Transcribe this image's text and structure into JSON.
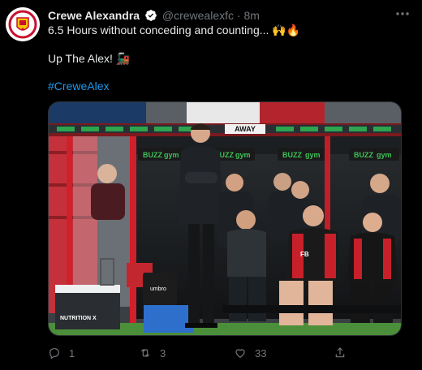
{
  "author": {
    "name": "Crewe Alexandra",
    "handle": "@crewealexfc",
    "time": "8m"
  },
  "tweet": {
    "line1": "6.5 Hours without conceding and counting... 🙌🔥",
    "line2": "Up The Alex! 🚂",
    "hashtag": "#CreweAlex"
  },
  "image_text": {
    "away_sign": "AWAY",
    "sponsor1": "BUZZ",
    "sponsor1b": "gym",
    "sponsor2": "BUZZ",
    "sponsor2b": "gym",
    "sponsor3": "BUZZ",
    "sponsor3b": "gym",
    "sponsor4": "BUZZ",
    "sponsor4b": "gym",
    "sponsor5": "BUZZ",
    "sponsor5b": "gym",
    "kit_brand": "umbro",
    "bin_label": "NUTRITION X",
    "shirt_initials": "FB"
  },
  "actions": {
    "replies": "1",
    "retweets": "3",
    "likes": "33"
  },
  "colors": {
    "background": "#000000",
    "text": "#e7e9ea",
    "muted": "#71767b",
    "link": "#1d9bf0",
    "verified": "#ffffff"
  },
  "icons": [
    "crest-icon",
    "verified-icon",
    "more-icon",
    "reply-icon",
    "retweet-icon",
    "like-icon",
    "share-icon"
  ]
}
